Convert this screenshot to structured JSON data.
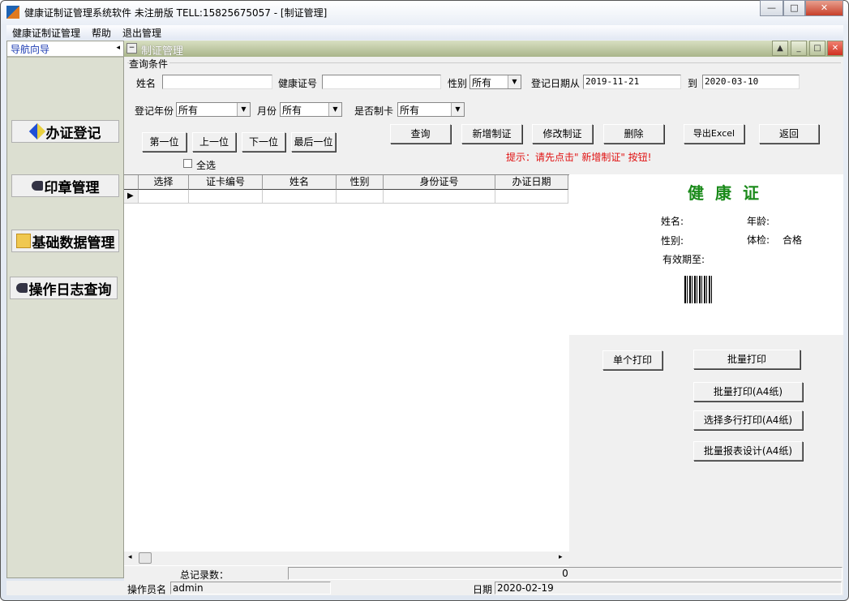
{
  "window": {
    "title": "健康证制证管理系统软件 未注册版 TELL:15825675057  - [制证管理]",
    "minimize": "—",
    "maximize": "□",
    "close": "✕"
  },
  "menu": [
    "健康证制证管理",
    "帮助",
    "退出管理"
  ],
  "nav": {
    "title": "导航向导",
    "collapse": "◂",
    "items": [
      {
        "label": "办证登记",
        "icon": "register-icon"
      },
      {
        "label": "印章管理",
        "icon": "seal-icon"
      },
      {
        "label": "基础数据管理",
        "icon": "folder-check-icon"
      },
      {
        "label": "操作日志查询",
        "icon": "log-icon"
      }
    ]
  },
  "inner": {
    "title": "制证管理",
    "collapse": "−",
    "buttons": [
      "▲",
      "_",
      "□",
      "✕"
    ]
  },
  "query": {
    "group": "查询条件",
    "name_label": "姓名",
    "name_value": "",
    "cert_label": "健康证号",
    "cert_value": "",
    "gender_label": "性别",
    "gender_value": "所有",
    "date_from_label": "登记日期从",
    "date_from": "2019-11-21",
    "date_to_label": "到",
    "date_to": "2020-03-10",
    "year_label": "登记年份",
    "year_value": "所有",
    "month_label": "月份",
    "month_value": "所有",
    "card_label": "是否制卡",
    "card_value": "所有"
  },
  "nav_buttons": [
    "第一位",
    "上一位",
    "下一位",
    "最后一位"
  ],
  "select_all": "全选",
  "actions": [
    "查询",
    "新增制证",
    "修改制证",
    "删除",
    "导出Excel",
    "返回"
  ],
  "hint": "提示：请先点击\" 新增制证\" 按钮!",
  "grid": {
    "columns": [
      "选择",
      "证卡编号",
      "姓名",
      "性别",
      "身份证号",
      "办证日期"
    ],
    "row_indicator": "▶"
  },
  "card": {
    "title": "健康证",
    "name_label": "姓名:",
    "age_label": "年龄:",
    "gender_label": "性别:",
    "exam_label": "体检:",
    "exam_value": "合格",
    "valid_label": "有效期至:"
  },
  "print": [
    "单个打印",
    "批量打印",
    "批量打印(A4纸)",
    "选择多行打印(A4纸)",
    "批量报表设计(A4纸)"
  ],
  "status": {
    "total_label": "总记录数：",
    "total_value": "0",
    "operator_label": "操作员名",
    "operator_value": "admin",
    "date_label": "日期",
    "date_value": "2020-02-19"
  },
  "colors": {
    "accent_green": "#1a8a1a",
    "hint_red": "#e01010",
    "nav_blue": "#1d3cb3"
  }
}
